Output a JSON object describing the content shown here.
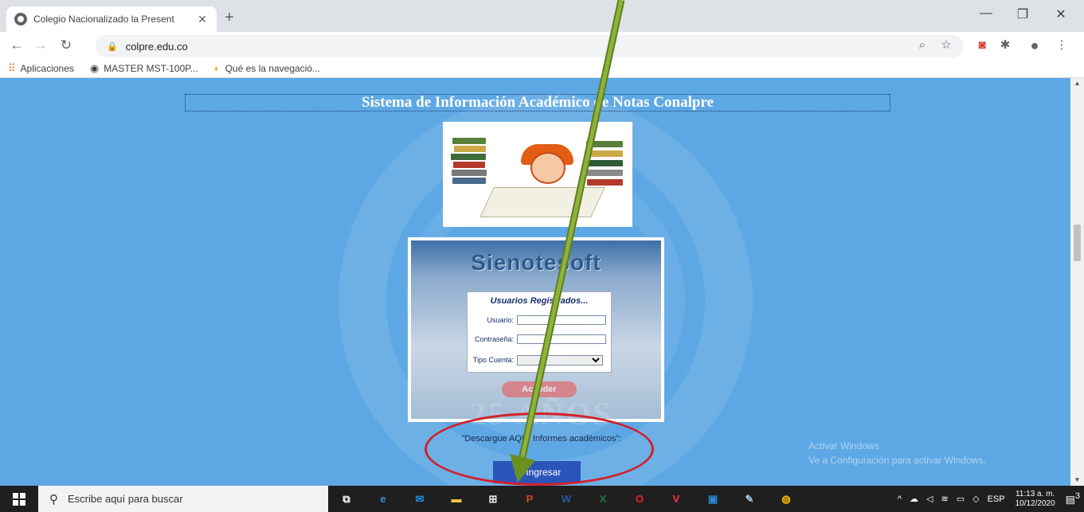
{
  "browser": {
    "tab_title": "Colegio Nacionalizado la Present",
    "tab_close": "✕",
    "new_tab": "+",
    "url": "colpre.edu.co",
    "bookmarks": [
      {
        "label": "Aplicaciones",
        "icon": "apps-grid-icon"
      },
      {
        "label": "MASTER MST-100P...",
        "icon": "globe-icon"
      },
      {
        "label": "Qué es la navegació...",
        "icon": "bookmark-site-icon"
      }
    ]
  },
  "page": {
    "heading": "Sistema de Información Académico de Notas Conalpre",
    "brand": "Sienotesoft",
    "form_title": "Usuarios Registrados...",
    "usuario_label": "Usuario:",
    "usuario_value": "",
    "password_label": "Contraseña:",
    "password_value": "",
    "tipo_label": "Tipo Cuenta:",
    "tipo_value": "",
    "acceder_label": "Acceder",
    "watermark": "25 AÑOS",
    "download_text": "\"Descargue AQUÍ Informes académicos\":",
    "ingresar_label": "Ingresar",
    "activate_line1": "Activar Windows",
    "activate_line2": "Ve a Configuración para activar Windows."
  },
  "taskbar": {
    "search_placeholder": "Escribe aquí para buscar",
    "apps": [
      "task-view",
      "edge",
      "mail",
      "file-explorer",
      "store",
      "powerpoint",
      "word",
      "excel",
      "opera",
      "vivaldi",
      "photos",
      "paint",
      "chrome"
    ],
    "language": "ESP",
    "time": "11:13 a. m.",
    "date": "10/12/2020",
    "notifications": "3"
  },
  "colors": {
    "page_background": "#5da8e4",
    "ingresar_button": "#2b55b8",
    "annotation_ellipse": "#d4202a",
    "annotation_arrow": "#7a9a2e"
  }
}
